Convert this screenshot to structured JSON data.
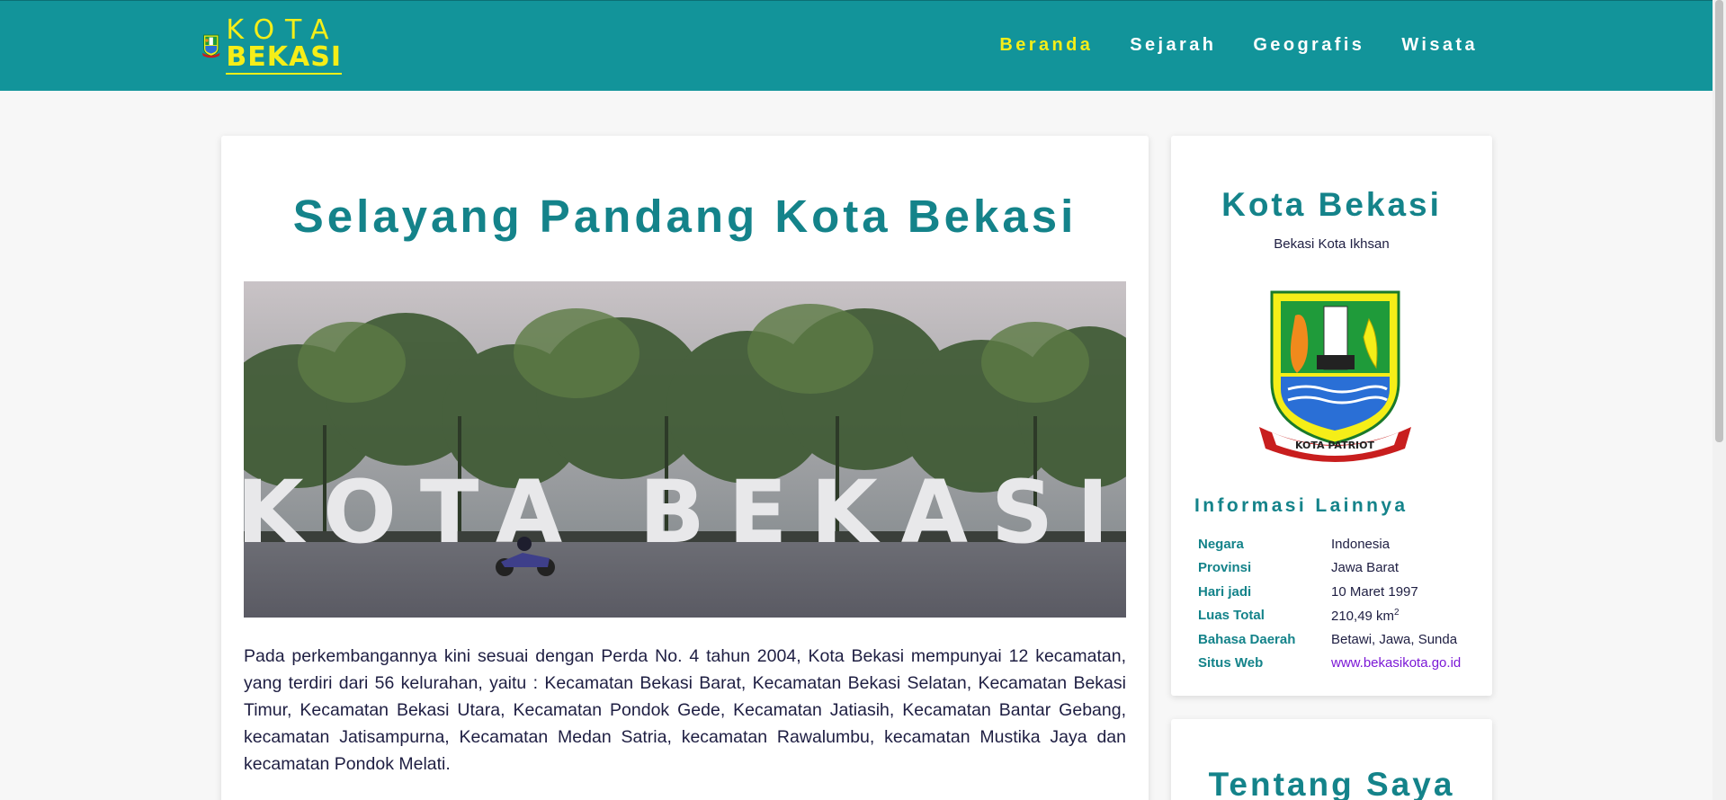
{
  "header": {
    "logo_line1": "KOTA",
    "logo_line2": "BEKASI",
    "nav": [
      {
        "label": "Beranda",
        "active": true
      },
      {
        "label": "Sejarah",
        "active": false
      },
      {
        "label": "Geografis",
        "active": false
      },
      {
        "label": "Wisata",
        "active": false
      }
    ]
  },
  "main": {
    "title": "Selayang Pandang Kota Bekasi",
    "hero_sign_text": "KOTA BEKASI",
    "intro": "Pada perkembangannya kini sesuai dengan Perda No. 4 tahun 2004, Kota Bekasi mempunyai 12 kecamatan, yang terdiri dari 56 kelurahan, yaitu : Kecamatan Bekasi Barat, Kecamatan Bekasi Selatan, Kecamatan Bekasi Timur, Kecamatan Bekasi Utara, Kecamatan Pondok Gede, Kecamatan Jatiasih, Kecamatan Bantar Gebang, kecamatan Jatisampurna, Kecamatan Medan Satria, kecamatan Rawalumbu, kecamatan Mustika Jaya dan kecamatan Pondok Melati."
  },
  "sidebar": {
    "title": "Kota Bekasi",
    "subtitle": "Bekasi Kota Ikhsan",
    "emblem_ribbon": "KOTA PATRIOT",
    "info_heading": "Informasi Lainnya",
    "info": [
      {
        "key": "Negara",
        "value": "Indonesia"
      },
      {
        "key": "Provinsi",
        "value": "Jawa Barat"
      },
      {
        "key": "Hari jadi",
        "value": "10 Maret 1997"
      },
      {
        "key": "Luas Total",
        "value": "210,49 km",
        "sup": "2"
      },
      {
        "key": "Bahasa Daerah",
        "value": "Betawi, Jawa, Sunda"
      },
      {
        "key": "Situs Web",
        "value": "www.bekasikota.go.id",
        "link": true
      }
    ],
    "about_title": "Tentang Saya"
  },
  "colors": {
    "header_bg": "#12949a",
    "accent_yellow": "#f5ee18",
    "title_teal": "#14838a",
    "link_purple": "#7b18d6"
  }
}
